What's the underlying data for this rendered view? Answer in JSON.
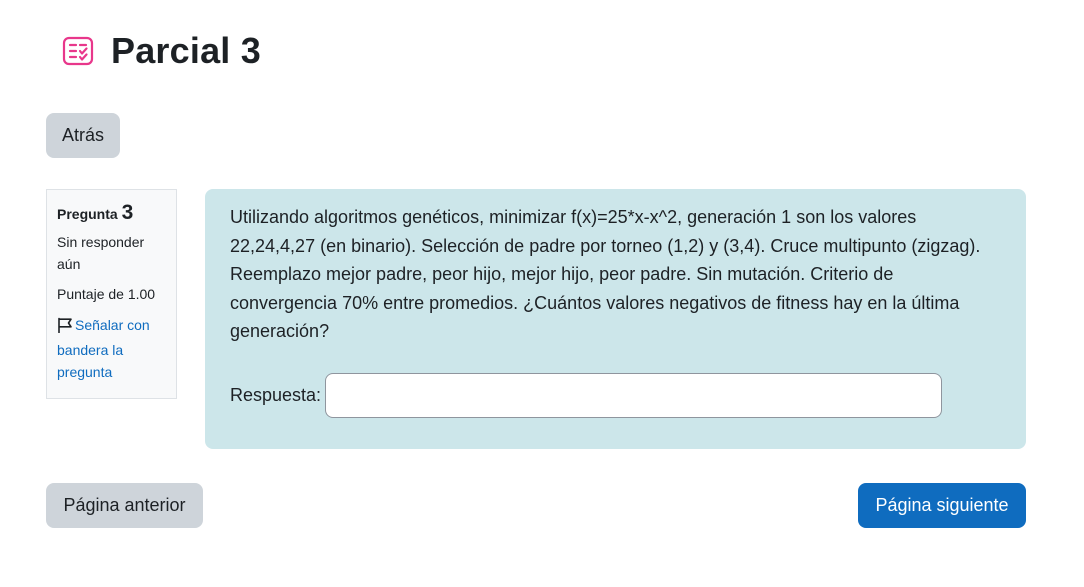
{
  "header": {
    "title": "Parcial 3",
    "icon": "quiz-icon",
    "icon_color": "#e8378b"
  },
  "nav": {
    "back_label": "Atrás",
    "prev_label": "Página anterior",
    "next_label": "Página siguiente"
  },
  "question_info": {
    "label": "Pregunta",
    "number": "3",
    "state": "Sin responder aún",
    "grade": "Puntaje de 1.00",
    "flag_label": "Señalar con bandera la pregunta"
  },
  "question": {
    "text": "Utilizando algoritmos genéticos, minimizar f(x)=25*x-x^2, generación 1 son los valores 22,24,4,27 (en binario). Selección de padre por torneo (1,2) y (3,4). Cruce multipunto (zigzag). Reemplazo mejor padre, peor hijo, mejor hijo, peor padre. Sin mutación. Criterio de convergencia 70% entre promedios. ¿Cuántos valores negativos de fitness hay en la última generación?",
    "answer_label": "Respuesta:",
    "answer_value": ""
  },
  "colors": {
    "primary": "#0f6cbf",
    "secondary": "#ced4da",
    "question_bg": "#cce6ea"
  }
}
